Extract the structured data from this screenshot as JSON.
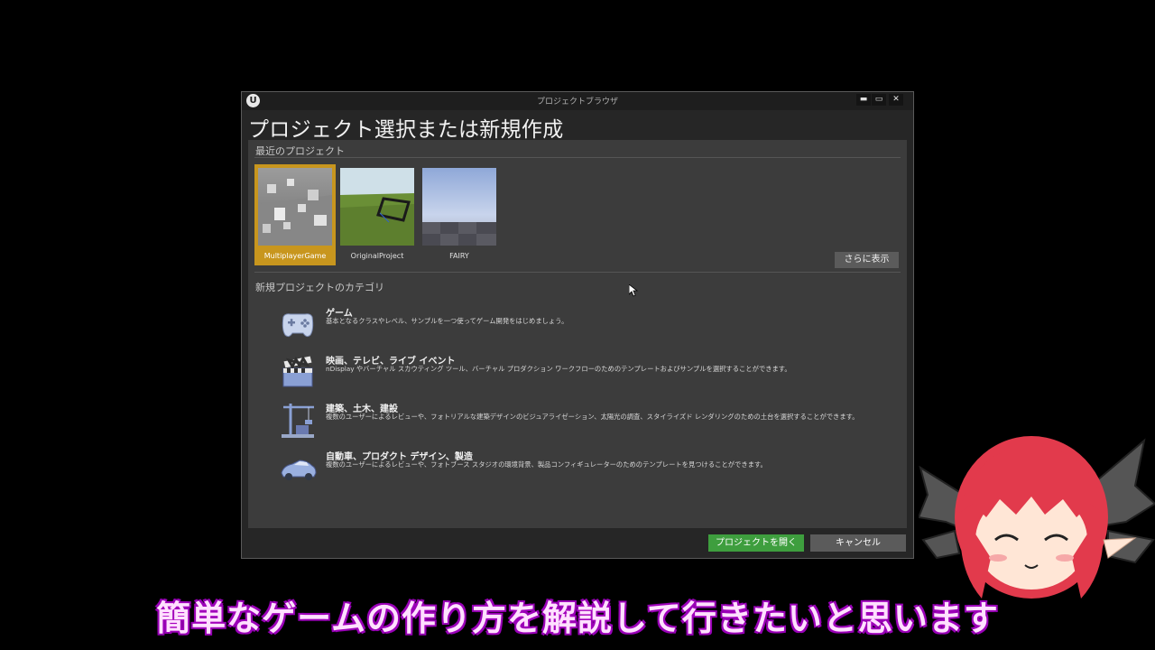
{
  "window": {
    "title": "プロジェクトブラウザ",
    "heading": "プロジェクト選択または新規作成",
    "controls": {
      "minimize": "▬",
      "maximize": "▭",
      "close": "✕"
    }
  },
  "recent": {
    "label": "最近のプロジェクト",
    "projects": [
      {
        "name": "MultiplayerGame",
        "selected": true
      },
      {
        "name": "OriginalProject",
        "selected": false
      },
      {
        "name": "FAIRY",
        "selected": false
      }
    ],
    "more_label": "さらに表示"
  },
  "categories": {
    "label": "新規プロジェクトのカテゴリ",
    "items": [
      {
        "title": "ゲーム",
        "desc": "基本となるクラスやレベル、サンプルを一つ使ってゲーム開発をはじめましょう。",
        "icon": "gamepad-icon"
      },
      {
        "title": "映画、テレビ、ライブ イベント",
        "desc": "nDisplay やバーチャル スカウティング ツール、バーチャル プロダクション ワークフローのためのテンプレートおよびサンプルを選択することができます。",
        "icon": "clapperboard-icon"
      },
      {
        "title": "建築、土木、建設",
        "desc": "複数のユーザーによるレビューや、フォトリアルな建築デザインのビジュアライゼーション、太陽光の調査、スタイライズド レンダリングのための土台を選択することができます。",
        "icon": "crane-icon"
      },
      {
        "title": "自動車、プロダクト デザイン、製造",
        "desc": "複数のユーザーによるレビューや、フォトブース スタジオの環境背景、製品コンフィギュレーターのためのテンプレートを見つけることができます。",
        "icon": "car-icon"
      }
    ]
  },
  "footer": {
    "open_label": "プロジェクトを開く",
    "cancel_label": "キャンセル"
  },
  "subtitle": "簡単なゲームの作り方を解説して行きたいと思います",
  "colors": {
    "accent_selected": "#c8961e",
    "open_button": "#3e9e3e",
    "subtitle_outline": "#9400b5"
  }
}
